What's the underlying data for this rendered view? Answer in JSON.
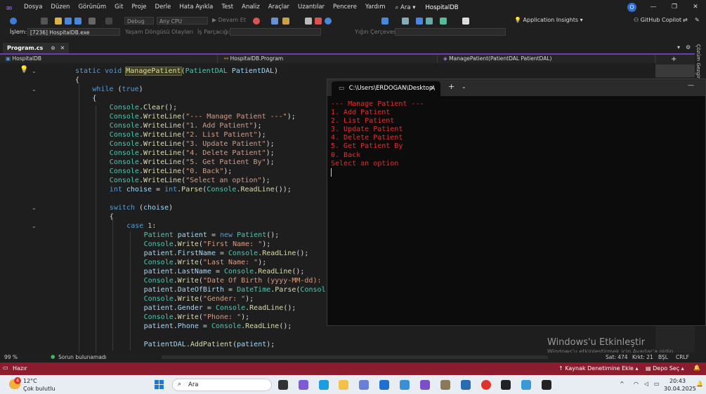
{
  "menu": {
    "items": [
      "Dosya",
      "Düzen",
      "Görünüm",
      "Git",
      "Proje",
      "Derle",
      "Hata Ayıkla",
      "Test",
      "Analiz",
      "Araçlar",
      "Uzantılar",
      "Pencere",
      "Yardım"
    ],
    "search": "Ara",
    "app_title": "HospitalDB",
    "avatar_initial": "O"
  },
  "toolbar": {
    "config": "Debug",
    "platform": "Any CPU",
    "continue": "Devam Et",
    "app_insights": "Application Insights",
    "copilot": "GitHub Copilot"
  },
  "debug_toolbar": {
    "process_label": "İşlem:",
    "process_value": "[7236] HospitalDB.exe",
    "lifecycle": "Yaşam Döngüsü Olayları",
    "thread": "İş Parçacığı:",
    "stack_frame": "Yığın Çerçevesi:"
  },
  "tabs": {
    "active": "Program.cs"
  },
  "navbar": {
    "project": "HospitalDB",
    "class": "HospitalDB.Program",
    "member": "ManagePatient(PatientDAL PatientDAL)"
  },
  "side_panel": {
    "label": "Çözüm Gezgini"
  },
  "code_lines": [
    {
      "indent": 0,
      "parts": [
        [
          "kw",
          "static "
        ],
        [
          "kw",
          "void "
        ],
        [
          "fn hl",
          "ManagePatient"
        ],
        [
          "pl",
          "("
        ],
        [
          "ty",
          "PatientDAL "
        ],
        [
          "id",
          "PatientDAL"
        ],
        [
          "pl",
          ")"
        ]
      ]
    },
    {
      "indent": 0,
      "parts": [
        [
          "pl",
          "{"
        ]
      ]
    },
    {
      "indent": 1,
      "parts": [
        [
          "kw",
          "while "
        ],
        [
          "pl",
          "("
        ],
        [
          "kw",
          "true"
        ],
        [
          "pl",
          ")"
        ]
      ]
    },
    {
      "indent": 1,
      "parts": [
        [
          "pl",
          "{"
        ]
      ]
    },
    {
      "indent": 2,
      "parts": [
        [
          "ty",
          "Console"
        ],
        [
          "pl",
          "."
        ],
        [
          "fn",
          "Clear"
        ],
        [
          "pl",
          "();"
        ]
      ]
    },
    {
      "indent": 2,
      "parts": [
        [
          "ty",
          "Console"
        ],
        [
          "pl",
          "."
        ],
        [
          "fn",
          "WriteLine"
        ],
        [
          "pl",
          "("
        ],
        [
          "st",
          "\"--- Manage Patient ---\""
        ],
        [
          "pl",
          ");"
        ]
      ]
    },
    {
      "indent": 2,
      "parts": [
        [
          "ty",
          "Console"
        ],
        [
          "pl",
          "."
        ],
        [
          "fn",
          "WriteLine"
        ],
        [
          "pl",
          "("
        ],
        [
          "st",
          "\"1. Add Patient\""
        ],
        [
          "pl",
          ");"
        ]
      ]
    },
    {
      "indent": 2,
      "parts": [
        [
          "ty",
          "Console"
        ],
        [
          "pl",
          "."
        ],
        [
          "fn",
          "WriteLine"
        ],
        [
          "pl",
          "("
        ],
        [
          "st",
          "\"2. List Patient\""
        ],
        [
          "pl",
          ");"
        ]
      ]
    },
    {
      "indent": 2,
      "parts": [
        [
          "ty",
          "Console"
        ],
        [
          "pl",
          "."
        ],
        [
          "fn",
          "WriteLine"
        ],
        [
          "pl",
          "("
        ],
        [
          "st",
          "\"3. Update Patient\""
        ],
        [
          "pl",
          ");"
        ]
      ]
    },
    {
      "indent": 2,
      "parts": [
        [
          "ty",
          "Console"
        ],
        [
          "pl",
          "."
        ],
        [
          "fn",
          "WriteLine"
        ],
        [
          "pl",
          "("
        ],
        [
          "st",
          "\"4. Delete Patient\""
        ],
        [
          "pl",
          ");"
        ]
      ]
    },
    {
      "indent": 2,
      "parts": [
        [
          "ty",
          "Console"
        ],
        [
          "pl",
          "."
        ],
        [
          "fn",
          "WriteLine"
        ],
        [
          "pl",
          "("
        ],
        [
          "st",
          "\"5. Get Patient By\""
        ],
        [
          "pl",
          ");"
        ]
      ]
    },
    {
      "indent": 2,
      "parts": [
        [
          "ty",
          "Console"
        ],
        [
          "pl",
          "."
        ],
        [
          "fn",
          "WriteLine"
        ],
        [
          "pl",
          "("
        ],
        [
          "st",
          "\"0. Back\""
        ],
        [
          "pl",
          ");"
        ]
      ]
    },
    {
      "indent": 2,
      "parts": [
        [
          "ty",
          "Console"
        ],
        [
          "pl",
          "."
        ],
        [
          "fn",
          "WriteLine"
        ],
        [
          "pl",
          "("
        ],
        [
          "st",
          "\"Select an option\""
        ],
        [
          "pl",
          ");"
        ]
      ]
    },
    {
      "indent": 2,
      "parts": [
        [
          "kw",
          "int "
        ],
        [
          "id",
          "choise"
        ],
        [
          "pl",
          " = "
        ],
        [
          "kw",
          "int"
        ],
        [
          "pl",
          "."
        ],
        [
          "fn",
          "Parse"
        ],
        [
          "pl",
          "("
        ],
        [
          "ty",
          "Console"
        ],
        [
          "pl",
          "."
        ],
        [
          "fn",
          "ReadLine"
        ],
        [
          "pl",
          "());"
        ]
      ]
    },
    {
      "indent": 2,
      "parts": []
    },
    {
      "indent": 2,
      "parts": [
        [
          "kw",
          "switch "
        ],
        [
          "pl",
          "("
        ],
        [
          "id",
          "choise"
        ],
        [
          "pl",
          ")"
        ]
      ]
    },
    {
      "indent": 2,
      "parts": [
        [
          "pl",
          "{"
        ]
      ]
    },
    {
      "indent": 3,
      "parts": [
        [
          "kw",
          "case "
        ],
        [
          "nm",
          "1"
        ],
        [
          "pl",
          ":"
        ]
      ]
    },
    {
      "indent": 4,
      "parts": [
        [
          "ty",
          "Patient "
        ],
        [
          "id",
          "patient"
        ],
        [
          "pl",
          " = "
        ],
        [
          "kw",
          "new "
        ],
        [
          "ty",
          "Patient"
        ],
        [
          "pl",
          "();"
        ]
      ]
    },
    {
      "indent": 4,
      "parts": [
        [
          "ty",
          "Console"
        ],
        [
          "pl",
          "."
        ],
        [
          "fn",
          "Write"
        ],
        [
          "pl",
          "("
        ],
        [
          "st",
          "\"First Name: \""
        ],
        [
          "pl",
          ");"
        ]
      ]
    },
    {
      "indent": 4,
      "parts": [
        [
          "id",
          "patient"
        ],
        [
          "pl",
          "."
        ],
        [
          "id",
          "FirstName"
        ],
        [
          "pl",
          " = "
        ],
        [
          "ty",
          "Console"
        ],
        [
          "pl",
          "."
        ],
        [
          "fn",
          "ReadLine"
        ],
        [
          "pl",
          "();"
        ]
      ]
    },
    {
      "indent": 4,
      "parts": [
        [
          "ty",
          "Console"
        ],
        [
          "pl",
          "."
        ],
        [
          "fn",
          "Write"
        ],
        [
          "pl",
          "("
        ],
        [
          "st",
          "\"Last Name: \""
        ],
        [
          "pl",
          ");"
        ]
      ]
    },
    {
      "indent": 4,
      "parts": [
        [
          "id",
          "patient"
        ],
        [
          "pl",
          "."
        ],
        [
          "id",
          "LastName"
        ],
        [
          "pl",
          " = "
        ],
        [
          "ty",
          "Console"
        ],
        [
          "pl",
          "."
        ],
        [
          "fn",
          "ReadLine"
        ],
        [
          "pl",
          "();"
        ]
      ]
    },
    {
      "indent": 4,
      "parts": [
        [
          "ty",
          "Console"
        ],
        [
          "pl",
          "."
        ],
        [
          "fn",
          "Write"
        ],
        [
          "pl",
          "("
        ],
        [
          "st",
          "\"Date Of Birth (yyyy-MM-dd): "
        ]
      ]
    },
    {
      "indent": 4,
      "parts": [
        [
          "id",
          "patient"
        ],
        [
          "pl",
          "."
        ],
        [
          "id",
          "DateOfBirth"
        ],
        [
          "pl",
          " = "
        ],
        [
          "ty",
          "DateTime"
        ],
        [
          "pl",
          "."
        ],
        [
          "fn",
          "Parse"
        ],
        [
          "pl",
          "("
        ],
        [
          "ty",
          "Consol"
        ]
      ]
    },
    {
      "indent": 4,
      "parts": [
        [
          "ty",
          "Console"
        ],
        [
          "pl",
          "."
        ],
        [
          "fn",
          "Write"
        ],
        [
          "pl",
          "("
        ],
        [
          "st",
          "\"Gender: \""
        ],
        [
          "pl",
          ");"
        ]
      ]
    },
    {
      "indent": 4,
      "parts": [
        [
          "id",
          "patient"
        ],
        [
          "pl",
          "."
        ],
        [
          "id",
          "Gender"
        ],
        [
          "pl",
          " = "
        ],
        [
          "ty",
          "Console"
        ],
        [
          "pl",
          "."
        ],
        [
          "fn",
          "ReadLine"
        ],
        [
          "pl",
          "();"
        ]
      ]
    },
    {
      "indent": 4,
      "parts": [
        [
          "ty",
          "Console"
        ],
        [
          "pl",
          "."
        ],
        [
          "fn",
          "Write"
        ],
        [
          "pl",
          "("
        ],
        [
          "st",
          "\"Phone: \""
        ],
        [
          "pl",
          ");"
        ]
      ]
    },
    {
      "indent": 4,
      "parts": [
        [
          "id",
          "patient"
        ],
        [
          "pl",
          "."
        ],
        [
          "id",
          "Phone"
        ],
        [
          "pl",
          " = "
        ],
        [
          "ty",
          "Console"
        ],
        [
          "pl",
          "."
        ],
        [
          "fn",
          "ReadLine"
        ],
        [
          "pl",
          "();"
        ]
      ]
    },
    {
      "indent": 4,
      "parts": []
    },
    {
      "indent": 4,
      "parts": [
        [
          "id",
          "PatientDAL"
        ],
        [
          "pl",
          "."
        ],
        [
          "fn",
          "AddPatient"
        ],
        [
          "pl",
          "("
        ],
        [
          "id",
          "patient"
        ],
        [
          "pl",
          ");"
        ]
      ]
    }
  ],
  "terminal": {
    "tab_title": "C:\\Users\\ERDOGAN\\Desktop\\",
    "lines": [
      "--- Manage Patient ---",
      "1. Add Patient",
      "2. List Patient",
      "3. Update Patient",
      "4. Delete Patient",
      "5. Get Patient By",
      "0. Back",
      "Select an option"
    ]
  },
  "editor_status": {
    "zoom": "99 %",
    "issues": "Sorun bulunamadı",
    "line": "Sat: 474",
    "char": "Krkt: 21",
    "whitespace": "BŞL",
    "line_ending": "CRLF"
  },
  "statusbar": {
    "ready": "Hazır",
    "source_control": "Kaynak Denetimine Ekle",
    "repo": "Depo Seç"
  },
  "watermark": {
    "title": "Windows'u Etkinleştir",
    "sub": "Windows'u etkinleştirmek için Ayarlar'a gidin."
  },
  "taskbar": {
    "weather_temp": "12°C",
    "weather_desc": "Çok bulutlu",
    "weather_badge": "4",
    "search": "Ara",
    "time": "20:43",
    "date": "30.04.2025"
  },
  "colors": {
    "statusbar": "#8a1c2e",
    "terminal_text": "#e03030",
    "accent": "#6b3fb3"
  }
}
